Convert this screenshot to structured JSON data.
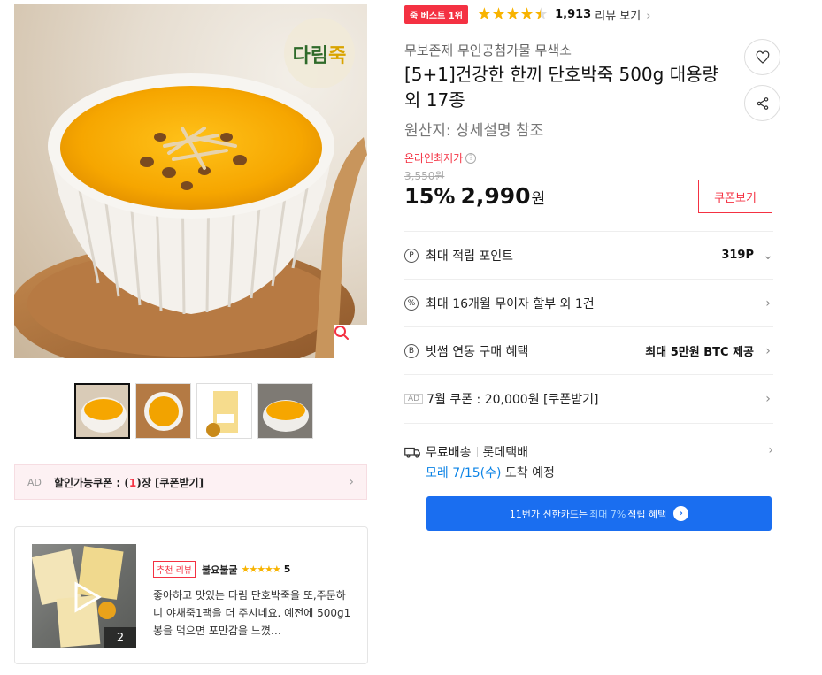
{
  "product": {
    "best_badge": "죽 베스트 1위",
    "rating_stars": 4.5,
    "review_count": "1,913",
    "review_link": "리뷰 보기",
    "brand": "무보존제 무인공첨가물 무색소",
    "title": "[5+1]건강한 한끼 단호박죽 500g 대용량 외 17종",
    "origin": "원산지:  상세설명 참조",
    "logo_text": "다림죽"
  },
  "price": {
    "lowest_label": "온라인최저가",
    "original": "3,550원",
    "discount": "15%",
    "sale": "2,990",
    "unit": "원",
    "coupon_button": "쿠폰보기"
  },
  "benefits": [
    {
      "icon": "P",
      "label": "최대 적립 포인트",
      "value": "319P"
    },
    {
      "icon": "%",
      "label": "최대 16개월 무이자 할부 외 1건",
      "value": ""
    },
    {
      "icon": "B",
      "label": "빗썸 연동 구매 혜택",
      "value": "최대 5만원 BTC 제공"
    },
    {
      "ad_tag": "AD",
      "label": "7월 쿠폰 : 20,000원 [쿠폰받기]",
      "value": ""
    }
  ],
  "shipping": {
    "free": "무료배송",
    "carrier": "롯데택배",
    "arrival_date": "모레 7/15(수)",
    "arrival_suffix": " 도착 예정"
  },
  "card_banner": {
    "prefix": "11번가 신한카드는",
    "highlight": "최대 7%",
    "suffix": "적립 혜택"
  },
  "ad_coupon": {
    "tag": "AD",
    "text_before": "할인가능쿠폰 : (",
    "count": "1",
    "text_after": ")장 [쿠폰받기]"
  },
  "review": {
    "badge": "추천 리뷰",
    "reviewer": "불요불굴",
    "stars": "★★★★★",
    "score": "5",
    "text": "좋아하고 맛있는 다림 단호박죽을 또,주문하니 야채죽1팩을 더 주시네요. 예전에 500g1봉을 먹으면 포만감을 느꼈…",
    "photo_count": "2"
  },
  "colors": {
    "accent_red": "#f43142",
    "star": "#f8b300",
    "blue": "#0b83e6",
    "banner": "#1a6ef0"
  }
}
